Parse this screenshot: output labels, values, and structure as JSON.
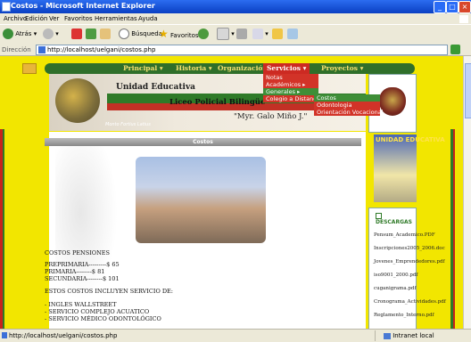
{
  "window": {
    "title": "Costos - Microsoft Internet Explorer"
  },
  "menu": [
    "Archivo",
    "Edición",
    "Ver",
    "Favoritos",
    "Herramientas",
    "Ayuda"
  ],
  "toolbar": {
    "back": "Atrás",
    "search": "Búsqueda",
    "favorites": "Favoritos"
  },
  "address": {
    "label": "Dirección",
    "url": "http://localhost/uelgani/costos.php"
  },
  "nav": {
    "principal": "Principal",
    "historia": "Historia",
    "organizacion": "Organización",
    "servicios": "Servicios",
    "proyectos": "Proyectos"
  },
  "dropdown_servicios": [
    "Notas",
    "Académicos",
    "Generales",
    "Colegio a Distancia"
  ],
  "dropdown_generales": [
    "Costos",
    "Odontologia",
    "Orientación Vocacional"
  ],
  "banner": {
    "line1": "Unidad Educativa",
    "line2": "Liceo Policial Bilingüe",
    "line3": "\"Myr. Galo Miño J.\"",
    "motto": "Monto Fortius Latius"
  },
  "section_title": "Costos",
  "content": {
    "heading": "COSTOS PENSIONES",
    "prices": [
      "PREPRIMARIA---------$ 65",
      "PRIMARIA--------$ 81",
      "SECUNDARIA--------$ 101"
    ],
    "note": "ESTOS COSTOS INCLUYEN SERVICIO DE:",
    "services": [
      "- INGLES WALLSTREET",
      "- SERVICIO COMPLEJO ACUATICO",
      "- SERVICIO MÉDICO ODONTOLÓGICO"
    ]
  },
  "sidebar": {
    "ad_title": "UNIDAD EDUCATIVA",
    "downloads_title": "DESCARGAS",
    "downloads": [
      "Pensum_Academico.PDF",
      "Inscripciones2005_2006.doc",
      "Jovenes_Emprendedores.pdf",
      "iso9001_2000.pdf",
      "cuganigrama.pdf",
      "Cronograma_Actividades.pdf",
      "Reglamento_Interno.pdf"
    ]
  },
  "status": {
    "text": "http://localhost/uelgani/costos.php",
    "zone": "Intranet local"
  }
}
